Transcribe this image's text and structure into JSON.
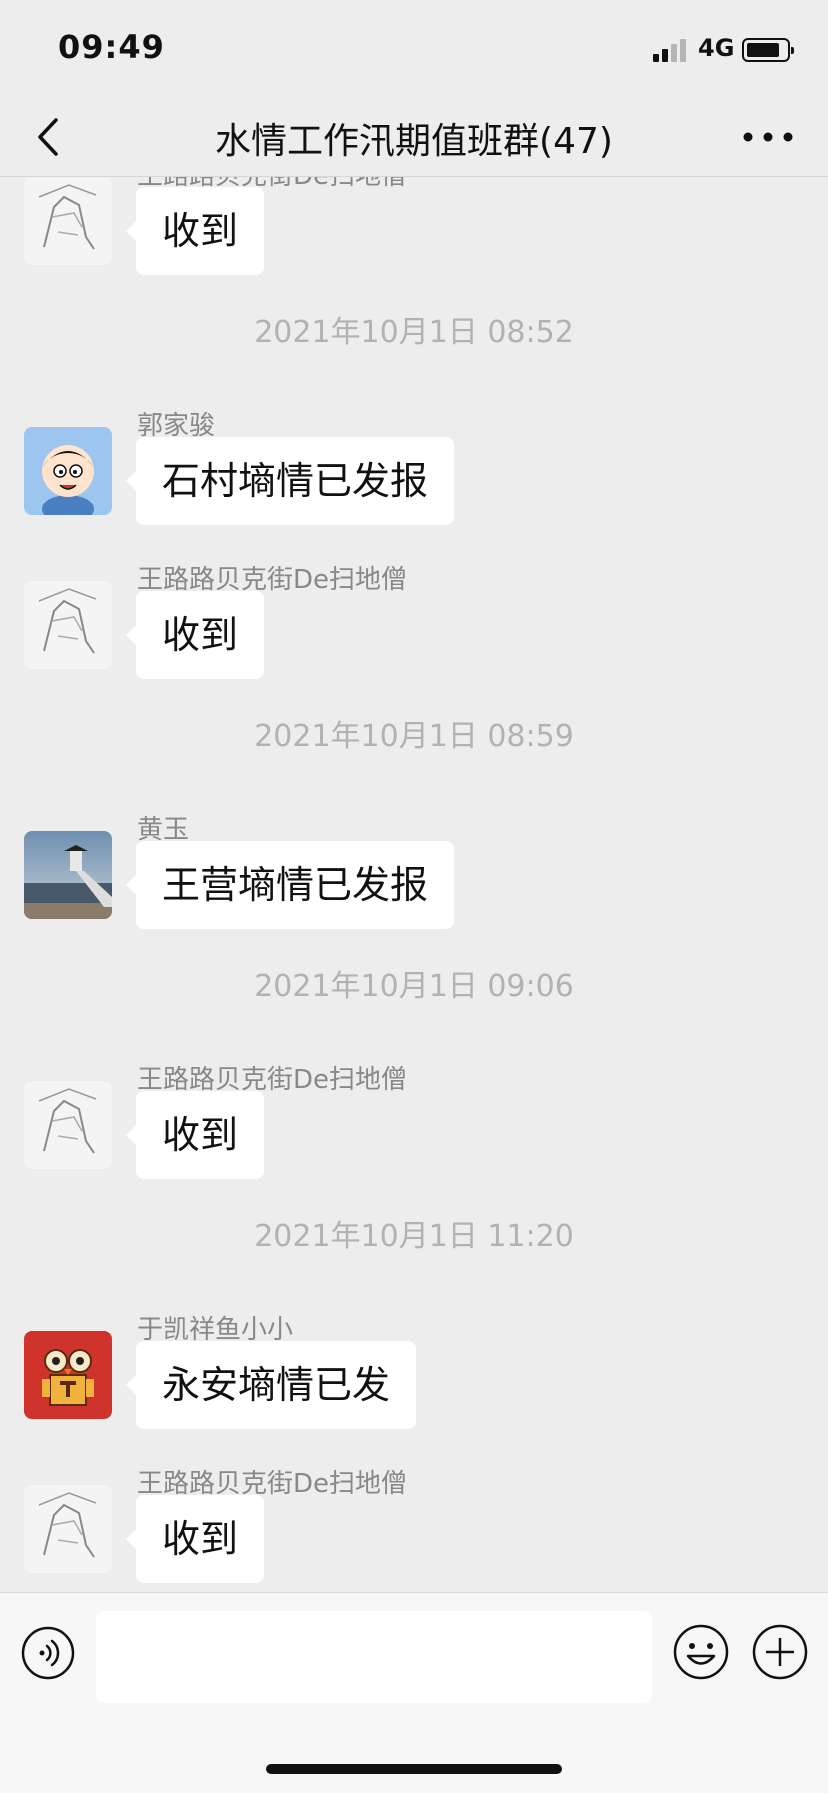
{
  "status": {
    "time": "09:49",
    "network": "4G",
    "battery_level": 0.72
  },
  "nav": {
    "title": "水情工作汛期值班群(47)"
  },
  "messages": [
    {
      "sender": "王路路贝克街De扫地僧",
      "text": "收到",
      "avatar": "sketch-avatar"
    },
    {
      "timestamp": "2021年10月1日 08:52"
    },
    {
      "sender": "郭家骏",
      "text": "石村墒情已发报",
      "avatar": "cartoon-boy-avatar"
    },
    {
      "sender": "王路路贝克街De扫地僧",
      "text": "收到",
      "avatar": "sketch-avatar"
    },
    {
      "timestamp": "2021年10月1日 08:59"
    },
    {
      "sender": "黄玉",
      "text": "王营墒情已发报",
      "avatar": "pavilion-lake-avatar"
    },
    {
      "timestamp": "2021年10月1日 09:06"
    },
    {
      "sender": "王路路贝克街De扫地僧",
      "text": "收到",
      "avatar": "sketch-avatar"
    },
    {
      "timestamp": "2021年10月1日 11:20"
    },
    {
      "sender": "于凯祥鱼小小",
      "text": "永安墒情已发",
      "avatar": "robot-owl-avatar"
    },
    {
      "sender": "王路路贝克街De扫地僧",
      "text": "收到",
      "avatar": "sketch-avatar"
    }
  ],
  "input": {
    "value": "",
    "placeholder": ""
  },
  "icons": {
    "back": "chevron-left-icon",
    "more": "more-dots-icon",
    "voice": "voice-icon",
    "emoji": "emoji-icon",
    "plus": "plus-icon"
  },
  "colors": {
    "background": "#ededed",
    "bubble": "#ffffff",
    "timestamp": "#b2b2b2",
    "sender": "#888888"
  }
}
